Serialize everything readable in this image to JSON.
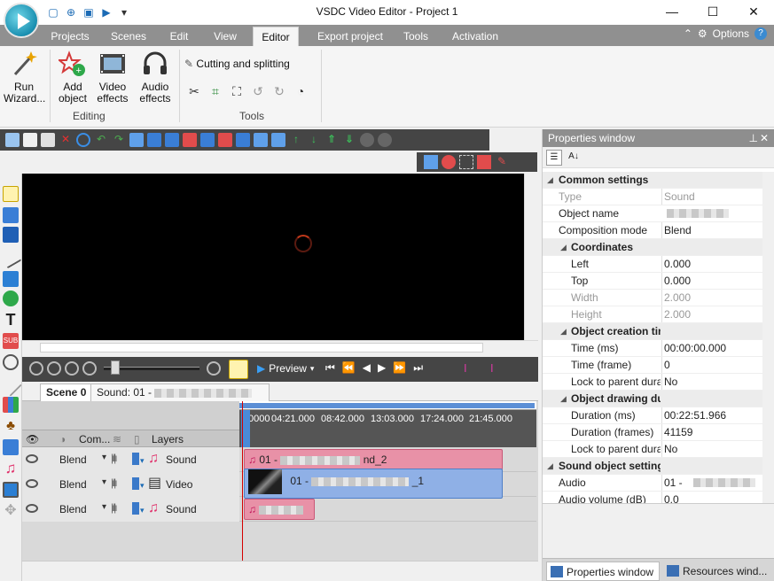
{
  "app": {
    "title": "VSDC Video Editor - Project 1",
    "window_controls": [
      "—",
      "☐",
      "✕"
    ],
    "quick_access": [
      "new-project-icon",
      "add-icon",
      "save-icon",
      "play-icon",
      "dropdown-icon"
    ]
  },
  "ribbon_tabs": [
    "Projects",
    "Scenes",
    "Edit",
    "View",
    "Editor",
    "Export project",
    "Tools",
    "Activation"
  ],
  "active_tab": "Editor",
  "options_label": "Options",
  "ribbon": {
    "run_wizard": "Run Wizard...",
    "add_object": "Add object",
    "video_effects": "Video effects",
    "audio_effects": "Audio effects",
    "editing_label": "Editing",
    "cutting_splitting": "Cutting and splitting",
    "tools_label": "Tools"
  },
  "playback": {
    "preview_label": "Preview",
    "transport": [
      "⏮",
      "⏪",
      "◀",
      "▶",
      "⏩",
      "⏭"
    ]
  },
  "scene_tabs": [
    "Scene 0",
    "Sound: 01 -",
    "_2"
  ],
  "timeline": {
    "col_composition": "Com...",
    "col_layers": "Layers",
    "ticks": [
      "0000",
      "04:21.000",
      "08:42.000",
      "13:03.000",
      "17:24.000",
      "21:45.000"
    ],
    "tracks": [
      {
        "blend": "Blend",
        "type": "Sound",
        "clip_prefix": "01 -",
        "clip_suffix": "nd_2"
      },
      {
        "blend": "Blend",
        "type": "Video",
        "clip_prefix": "01 -",
        "clip_suffix": "_1"
      },
      {
        "blend": "Blend",
        "type": "Sound",
        "clip_prefix": "",
        "clip_suffix": ""
      }
    ]
  },
  "properties": {
    "title": "Properties window",
    "rows": [
      {
        "kind": "cat",
        "k": "Common settings",
        "v": ""
      },
      {
        "kind": "dim",
        "k": "Type",
        "v": "Sound"
      },
      {
        "kind": "row",
        "k": "Object name",
        "v": ""
      },
      {
        "kind": "row",
        "k": "Composition mode",
        "v": "Blend"
      },
      {
        "kind": "subcat",
        "k": "Coordinates",
        "v": ""
      },
      {
        "kind": "sub",
        "k": "Left",
        "v": "0.000"
      },
      {
        "kind": "sub",
        "k": "Top",
        "v": "0.000"
      },
      {
        "kind": "subdim",
        "k": "Width",
        "v": "2.000"
      },
      {
        "kind": "subdim",
        "k": "Height",
        "v": "2.000"
      },
      {
        "kind": "subcat",
        "k": "Object creation time",
        "v": ""
      },
      {
        "kind": "sub",
        "k": "Time (ms)",
        "v": "00:00:00.000"
      },
      {
        "kind": "sub",
        "k": "Time (frame)",
        "v": "0"
      },
      {
        "kind": "sub",
        "k": "Lock to parent durati",
        "v": "No"
      },
      {
        "kind": "subcat",
        "k": "Object drawing duration",
        "v": ""
      },
      {
        "kind": "sub",
        "k": "Duration (ms)",
        "v": "00:22:51.966"
      },
      {
        "kind": "sub",
        "k": "Duration (frames)",
        "v": "41159"
      },
      {
        "kind": "sub",
        "k": "Lock to parent durati",
        "v": "No"
      },
      {
        "kind": "cat",
        "k": "Sound object settings",
        "v": ""
      },
      {
        "kind": "row",
        "k": "Audio",
        "v": "01 -"
      },
      {
        "kind": "row",
        "k": "Audio volume (dB)",
        "v": "0.0"
      }
    ],
    "bottom_tabs": [
      "Properties window",
      "Resources wind..."
    ]
  }
}
